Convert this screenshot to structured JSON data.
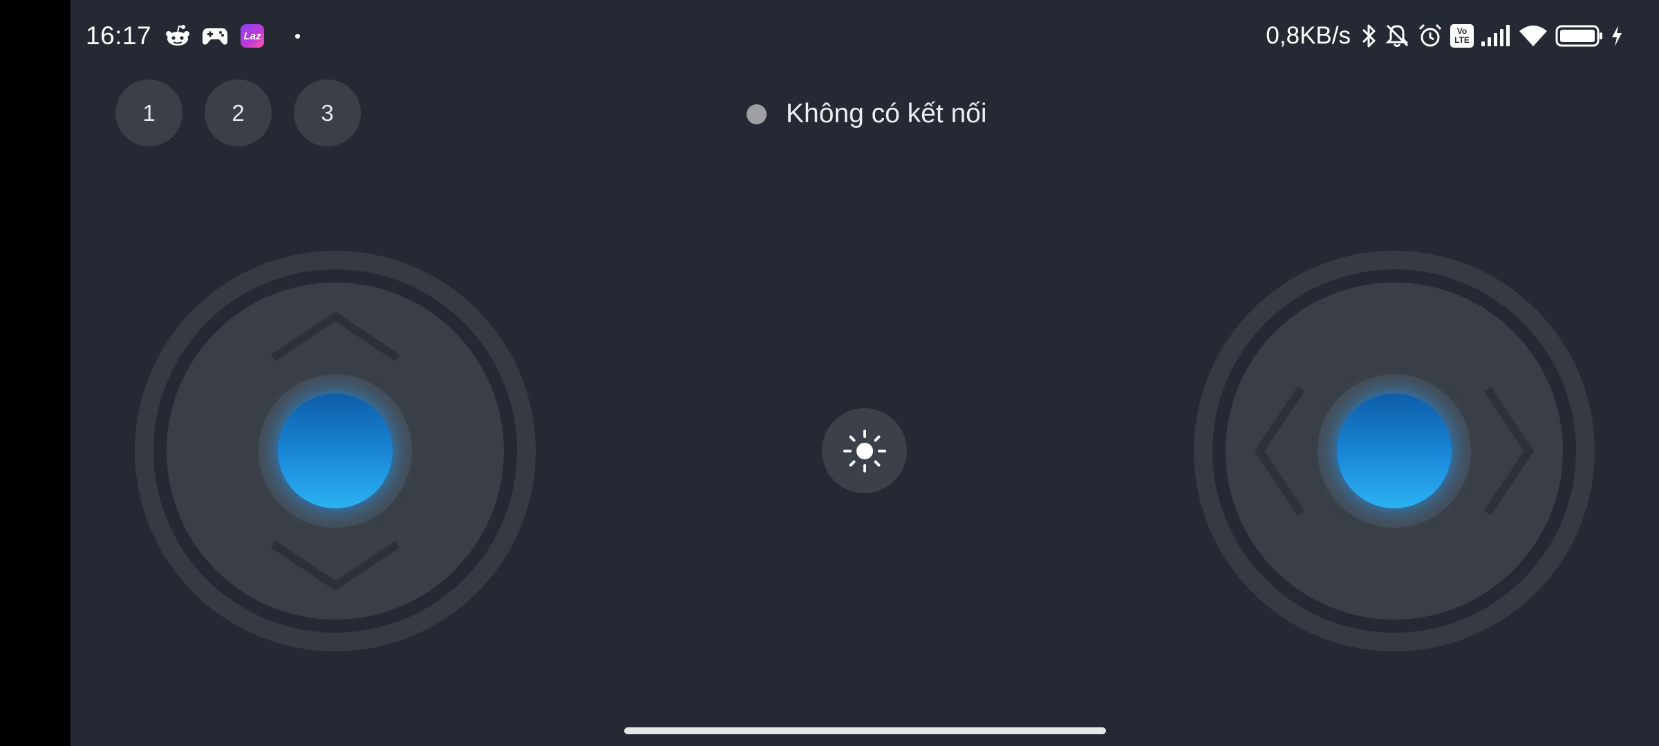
{
  "status_bar": {
    "time": "16:17",
    "left_icons": [
      "reddit-icon",
      "gamepad-icon",
      "lazada-icon",
      "notification-dot"
    ],
    "lazada_label": "Laz",
    "net_speed": "0,8KB/s",
    "volte_label_top": "Vo",
    "volte_label_bottom": "LTE",
    "right_icons": [
      "bluetooth-icon",
      "bell-muted-icon",
      "alarm-icon",
      "volte-icon",
      "signal-icon",
      "wifi-icon",
      "battery-icon",
      "charging-icon"
    ]
  },
  "presets": [
    {
      "label": "1"
    },
    {
      "label": "2"
    },
    {
      "label": "3"
    }
  ],
  "connection": {
    "status_text": "Không có kết nối",
    "dot_color": "#9d9fa3"
  },
  "controls": {
    "left_joystick_axis": "vertical",
    "right_joystick_axis": "horizontal",
    "light_button_icon": "sun-icon"
  },
  "colors": {
    "background": "#242933",
    "control_surface": "#3a3f47",
    "knob_accent": "#1a8ad9"
  }
}
